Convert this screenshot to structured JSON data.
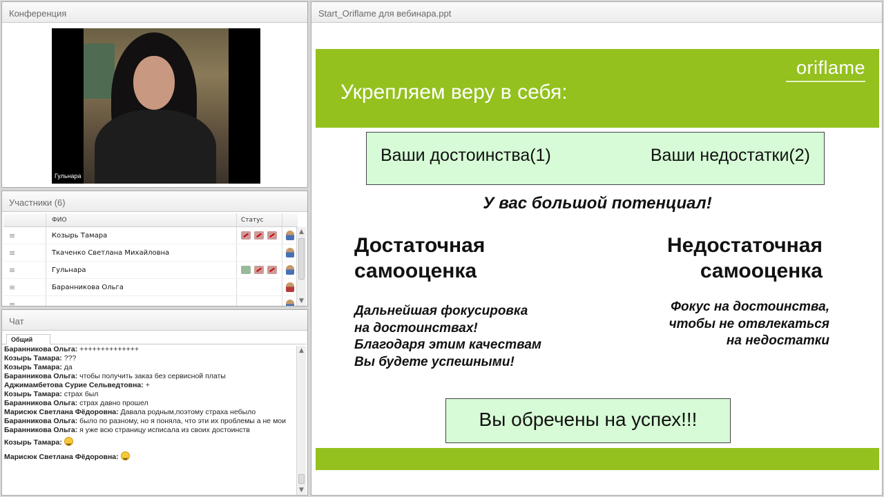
{
  "conference": {
    "title": "Конференция",
    "video_caption": "Гульнара"
  },
  "participants": {
    "title": "Участники (6)",
    "columns": {
      "name": "ФИО",
      "status": "Статус"
    },
    "rows": [
      {
        "name": "Козырь Тамара",
        "status_icons": [
          "mic-off-icon",
          "cam-off-icon",
          "screen-off-icon"
        ],
        "avatar": "user-icon"
      },
      {
        "name": "Ткаченко Светлана  Михайловна",
        "status_icons": [],
        "avatar": "user-icon"
      },
      {
        "name": "Гульнара",
        "status_icons": [
          "mic-on-icon",
          "cam-off-icon",
          "screen-off-icon"
        ],
        "avatar": "presenter-icon"
      },
      {
        "name": "Баранникова Ольга",
        "status_icons": [],
        "avatar": "user-icon-red"
      },
      {
        "name": "",
        "status_icons": [],
        "avatar": "user-icon"
      }
    ]
  },
  "chat": {
    "title": "Чат",
    "tab": "Общий",
    "messages": [
      {
        "author": "Баранникова Ольга:",
        "text": "++++++++++++++"
      },
      {
        "author": "Козырь Тамара:",
        "text": "???"
      },
      {
        "author": "Козырь Тамара:",
        "text": "да"
      },
      {
        "author": "Баранникова Ольга:",
        "text": "чтобы получить заказ без сервисной платы"
      },
      {
        "author": "Аджимамбетова Сурие  Сельведтовна:",
        "text": "+"
      },
      {
        "author": "Козырь Тамара:",
        "text": "страх был"
      },
      {
        "author": "Баранникова Ольга:",
        "text": "страх давно прошел"
      },
      {
        "author": "Марисюк Светлана  Фёдоровна:",
        "text": "Давала родным,поэтому страха небыло"
      },
      {
        "author": "Баранникова Ольга:",
        "text": "было по разному, но я поняла, что эти их проблемы а не мои"
      },
      {
        "author": "Баранникова Ольга:",
        "text": "я уже всю страницу исписала из своих достоинств"
      },
      {
        "author": "Козырь Тамара:",
        "text": "",
        "emoji": "smile-icon"
      },
      {
        "author": "Марисюк Светлана  Фёдоровна:",
        "text": "",
        "emoji": "smile-icon"
      }
    ]
  },
  "presentation": {
    "file_title": "Start_Oriflame для вебинара.ppt",
    "logo": "oriflame",
    "slide_title": "Укрепляем веру в себя:",
    "box_left": "Ваши достоинства(1)",
    "box_right": "Ваши недостатки(2)",
    "potential": "У вас большой потенциал!",
    "left_heading_1": "Достаточная",
    "left_heading_2": "самооценка",
    "right_heading_1": "Недостаточная",
    "right_heading_2": "самооценка",
    "left_text": [
      "Дальнейшая фокусировка",
      "на достоинствах!",
      "Благодаря этим качествам",
      "Вы будете успешными!"
    ],
    "right_text": [
      "Фокус на достоинства,",
      "чтобы не отвлекаться",
      "на недостатки"
    ],
    "bottom_box": "Вы обречены на успех!!!",
    "accent_color": "#94c11e",
    "box_color": "#d6fbd6"
  }
}
